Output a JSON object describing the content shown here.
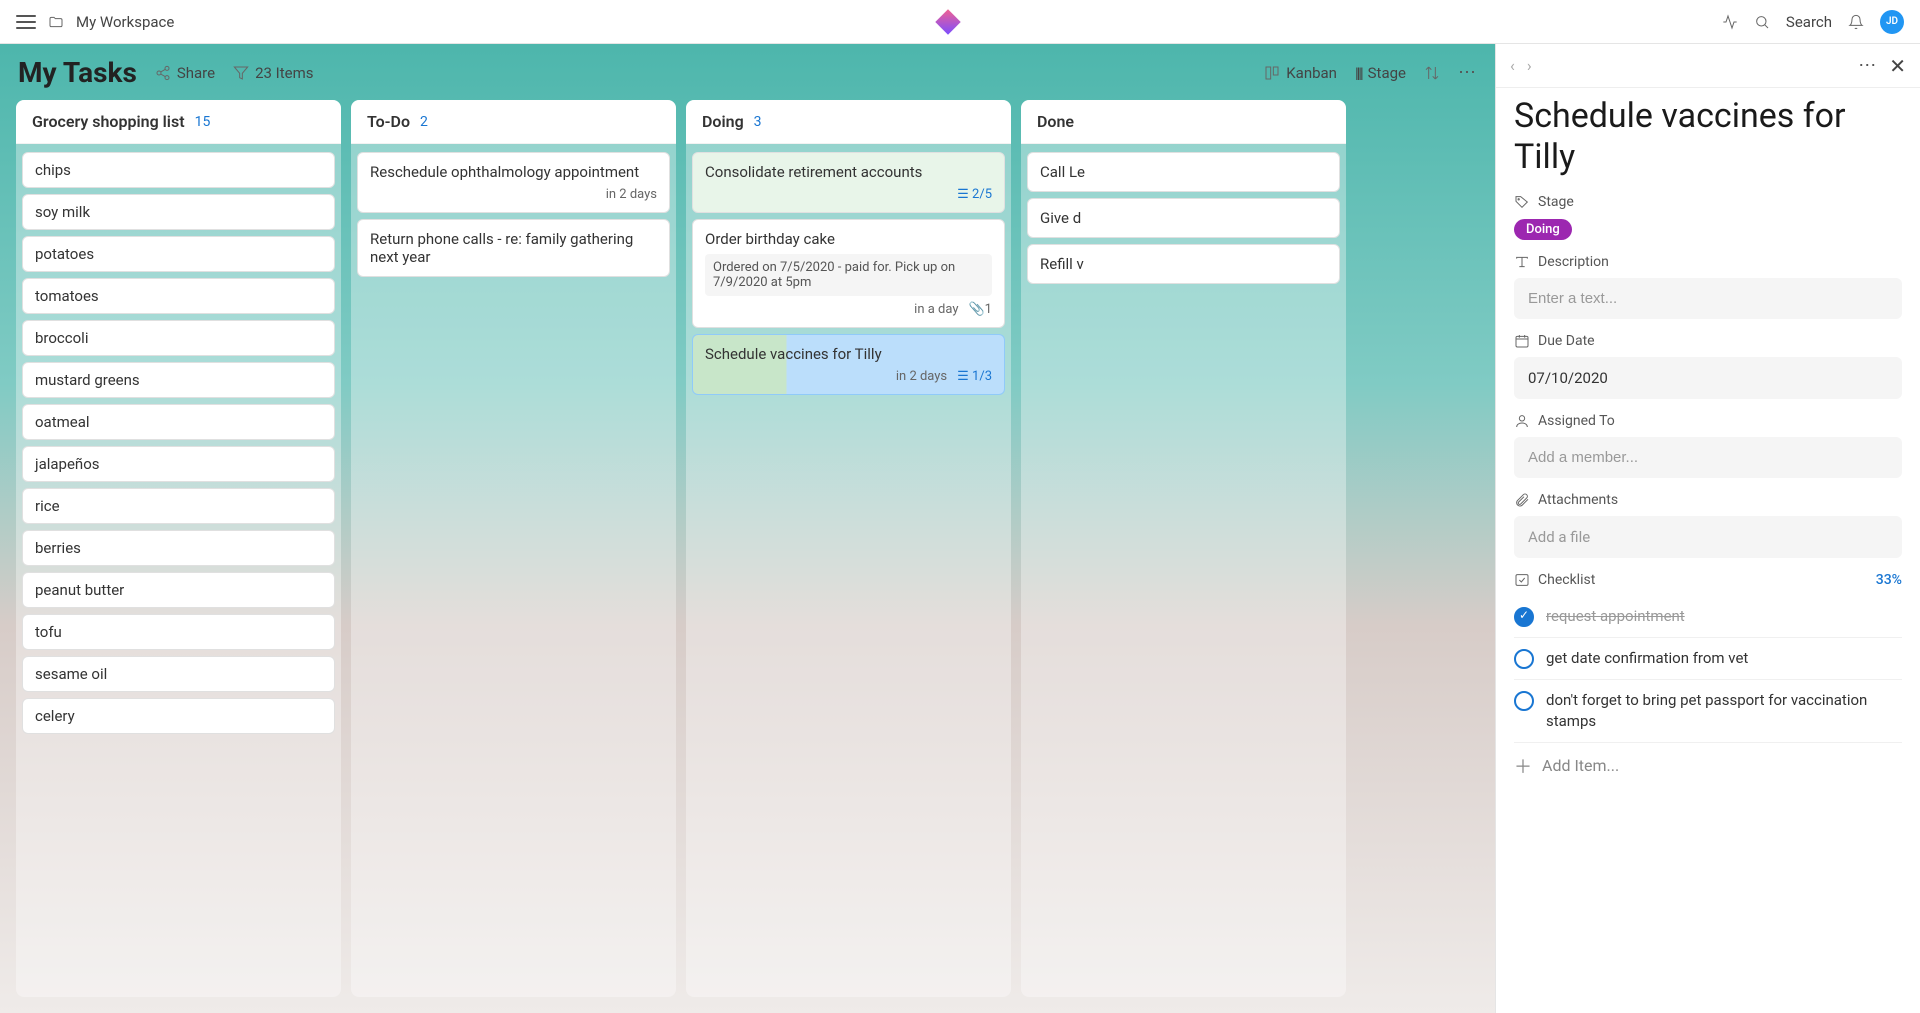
{
  "topbar": {
    "workspace": "My Workspace",
    "search": "Search",
    "avatar": "JD"
  },
  "board": {
    "title": "My Tasks",
    "share": "Share",
    "items_count": "23 Items",
    "view": "Kanban",
    "grouping": "Stage"
  },
  "columns": [
    {
      "name": "Grocery shopping list",
      "count": "15",
      "cards": [
        {
          "title": "chips"
        },
        {
          "title": "soy milk"
        },
        {
          "title": "potatoes"
        },
        {
          "title": "tomatoes"
        },
        {
          "title": "broccoli"
        },
        {
          "title": "mustard greens"
        },
        {
          "title": "oatmeal"
        },
        {
          "title": "jalapeños"
        },
        {
          "title": "rice"
        },
        {
          "title": "berries"
        },
        {
          "title": "peanut butter"
        },
        {
          "title": "tofu"
        },
        {
          "title": "sesame oil"
        },
        {
          "title": "celery"
        }
      ]
    },
    {
      "name": "To-Do",
      "count": "2",
      "cards": [
        {
          "title": "Reschedule ophthalmology appointment",
          "due": "in 2 days"
        },
        {
          "title": "Return phone calls - re: family gathering next year"
        }
      ]
    },
    {
      "name": "Doing",
      "count": "3",
      "cards": [
        {
          "title": "Consolidate retirement accounts",
          "checklist": "2/5",
          "tint": "green"
        },
        {
          "title": "Order birthday cake",
          "note": "Ordered on 7/5/2020 - paid for. Pick up on 7/9/2020 at 5pm",
          "due": "in a day",
          "attach": "1"
        },
        {
          "title": "Schedule vaccines for Tilly",
          "due": "in 2 days",
          "checklist": "1/3",
          "selected": true
        }
      ]
    },
    {
      "name": "Done",
      "count": "",
      "cards": [
        {
          "title": "Call Le"
        },
        {
          "title": "Give d"
        },
        {
          "title": "Refill v"
        }
      ]
    }
  ],
  "detail": {
    "title": "Schedule vaccines for Tilly",
    "stage_label": "Stage",
    "stage_value": "Doing",
    "description_label": "Description",
    "description_placeholder": "Enter a text...",
    "due_label": "Due Date",
    "due_value": "07/10/2020",
    "assigned_label": "Assigned To",
    "assigned_placeholder": "Add a member...",
    "attachments_label": "Attachments",
    "attachments_placeholder": "Add a file",
    "checklist_label": "Checklist",
    "checklist_pct": "33%",
    "checklist": [
      {
        "text": "request appointment",
        "done": true
      },
      {
        "text": "get date confirmation from vet",
        "done": false
      },
      {
        "text": "don't forget to bring pet passport for vaccination stamps",
        "done": false
      }
    ],
    "add_item": "Add Item..."
  }
}
